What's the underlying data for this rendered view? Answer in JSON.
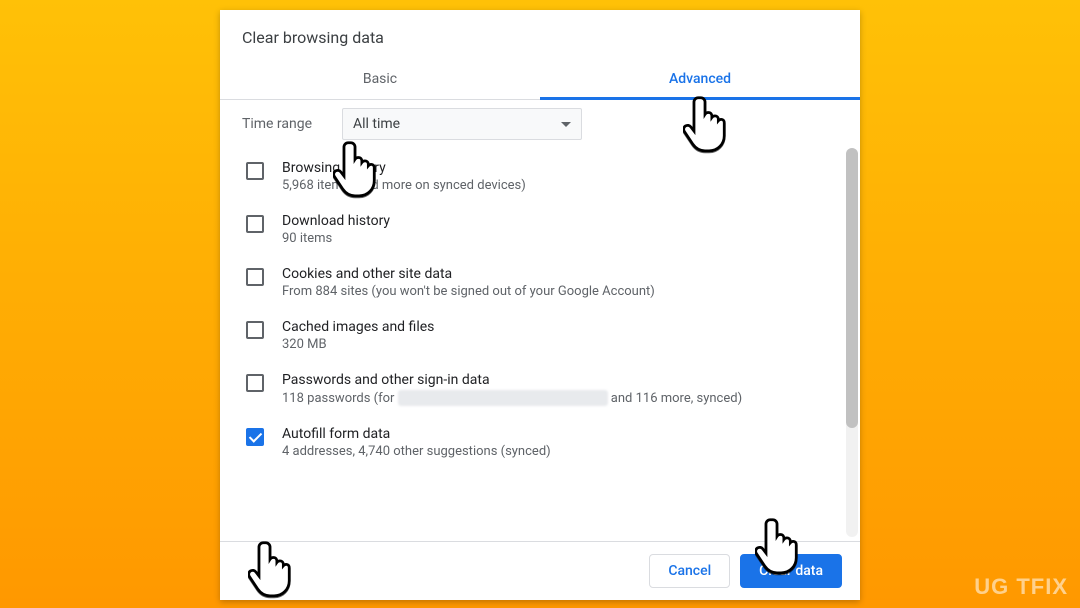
{
  "dialog": {
    "title": "Clear browsing data",
    "tabs": {
      "basic": "Basic",
      "advanced": "Advanced",
      "active": "advanced"
    },
    "time_range_label": "Time range",
    "time_range_value": "All time",
    "items": [
      {
        "title": "Browsing history",
        "sub": "5,968 items (and more on synced devices)",
        "checked": false
      },
      {
        "title": "Download history",
        "sub": "90 items",
        "checked": false
      },
      {
        "title": "Cookies and other site data",
        "sub": "From 884 sites (you won't be signed out of your Google Account)",
        "checked": false
      },
      {
        "title": "Cached images and files",
        "sub": "320 MB",
        "checked": false
      },
      {
        "title": "Passwords and other sign-in data",
        "sub_prefix": "118 passwords (for ",
        "sub_blur": "████████████ ██████████",
        "sub_suffix": " and 116 more, synced)",
        "checked": false
      },
      {
        "title": "Autofill form data",
        "sub": "4 addresses, 4,740 other suggestions (synced)",
        "checked": true
      }
    ],
    "buttons": {
      "cancel": "Cancel",
      "clear": "Clear data"
    }
  },
  "watermark": "UG  TFIX"
}
